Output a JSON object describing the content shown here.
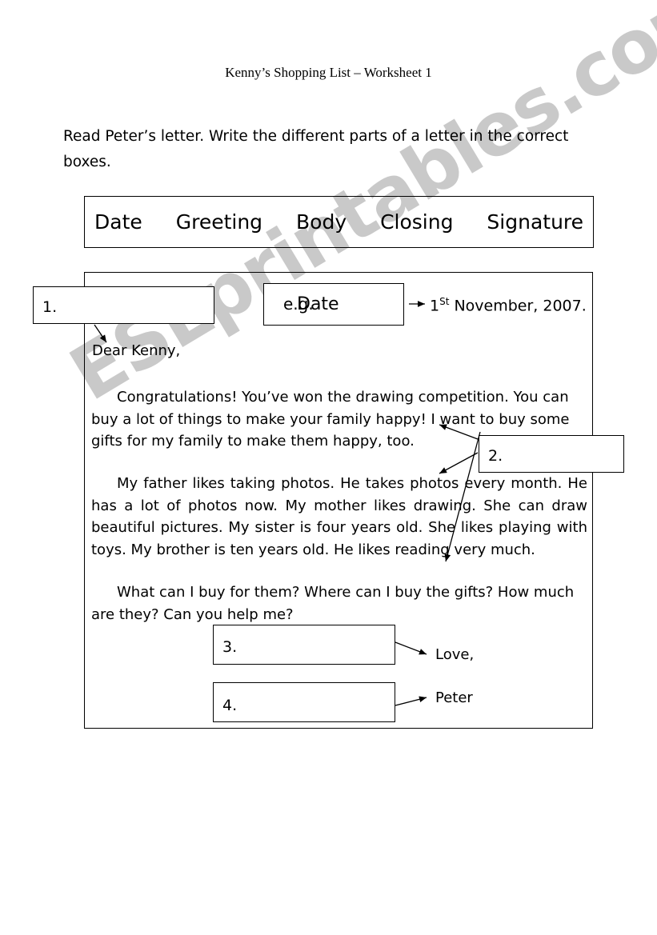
{
  "document": {
    "title": "Kenny’s Shopping List – Worksheet 1",
    "instructions": "Read Peter’s letter. Write the different parts of a letter in the correct boxes.",
    "watermark": "ESLprintables.com"
  },
  "word_bank": {
    "terms": [
      "Date",
      "Greeting",
      "Body",
      "Closing",
      "Signature"
    ]
  },
  "answer_boxes": {
    "box1": "1.",
    "box2": "2.",
    "box3": "3.",
    "box4": "4.",
    "example_label": "e.g.",
    "example_answer": "Date"
  },
  "letter": {
    "date_number": "1",
    "date_suffix": "St",
    "date_rest": " November, 2007.",
    "salutation": "Dear Kenny,",
    "paragraph1": "Congratulations! You’ve won the drawing competition. You can buy a lot of things to make your family happy! I want to buy some gifts for my family to make them happy, too.",
    "paragraph2": "My father likes taking photos. He takes photos every month. He has a lot of photos now. My mother likes drawing. She can draw beautiful pictures. My sister is four years old. She likes playing with toys. My brother is ten years old. He likes reading very much.",
    "paragraph3": "What can I buy for them? Where can I buy the gifts? How much are they? Can you help me?",
    "closing": "Love,",
    "signature": "Peter"
  },
  "colors": {
    "ink": "#000000",
    "paper": "#ffffff",
    "watermark": "#c9c9c9"
  }
}
